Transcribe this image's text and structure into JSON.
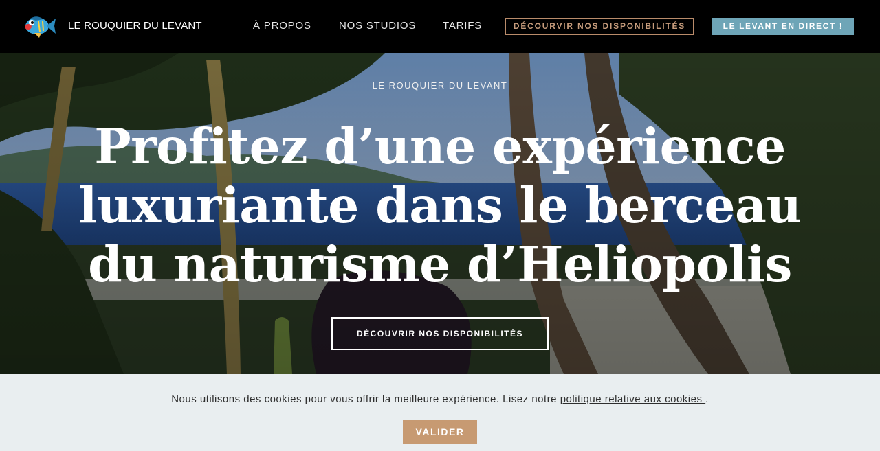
{
  "nav": {
    "brand": "LE ROUQUIER DU LEVANT",
    "links": [
      "À PROPOS",
      "NOS STUDIOS",
      "TARIFS"
    ],
    "cta_outline": "DÉCOURVIR NOS DISPONIBILITÉS",
    "cta_fill": "LE LEVANT EN DIRECT !"
  },
  "hero": {
    "eyebrow": "LE ROUQUIER DU LEVANT",
    "headline": "Profitez d’une expérience luxuriante dans le berceau du naturisme d’Heliopolis",
    "cta": "DÉCOUVRIR NOS DISPONIBILITÉS"
  },
  "cookie": {
    "text_before": "Nous utilisons des cookies pour vous offrir la meilleure expérience. Lisez notre ",
    "link": "politique relative aux cookies ",
    "text_after": ".",
    "button": "VALIDER"
  },
  "colors": {
    "nav_bg": "#000000",
    "accent_brown": "#c79a72",
    "accent_blue": "#6ea5b7",
    "cookie_bg": "#e9eef0"
  },
  "icons": {
    "logo": "fish-logo"
  }
}
